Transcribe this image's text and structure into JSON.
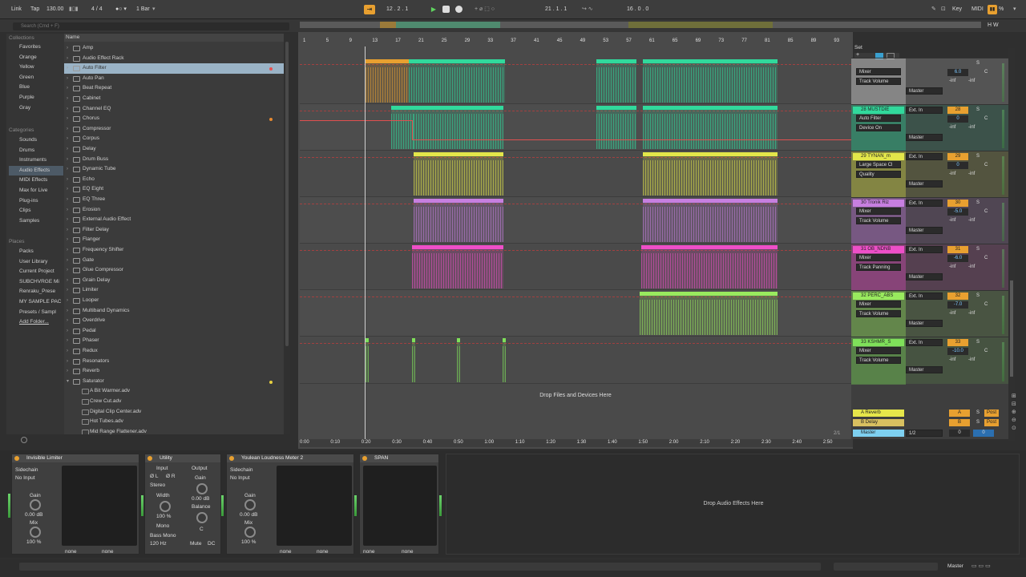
{
  "top": {
    "link": "Link",
    "tap": "Tap",
    "tempo": "130.00",
    "sig": "4 / 4",
    "quant": "1 Bar",
    "pos": "12 .  2 .  1",
    "loop_start": "21 .  1 .  1",
    "loop_len": "16 .  0 .  0",
    "key": "Key",
    "midi": "MIDI",
    "cpu": "%"
  },
  "browser": {
    "search": "Search (Cmd + F)",
    "collections_title": "Collections",
    "collections": [
      {
        "label": "Favorites",
        "color": "#e85050"
      },
      {
        "label": "Orange",
        "color": "#e88a30"
      },
      {
        "label": "Yellow",
        "color": "#e8d040"
      },
      {
        "label": "Green",
        "color": "#60c060"
      },
      {
        "label": "Blue",
        "color": "#4090e0"
      },
      {
        "label": "Purple",
        "color": "#a060d0"
      },
      {
        "label": "Gray",
        "color": "#999999"
      }
    ],
    "categories_title": "Categories",
    "categories": [
      "Sounds",
      "Drums",
      "Instruments",
      "Audio Effects",
      "MIDI Effects",
      "Max for Live",
      "Plug-ins",
      "Clips",
      "Samples"
    ],
    "places_title": "Places",
    "places": [
      "Packs",
      "User Library",
      "Current Project",
      "SUBCHVRGE Mi",
      "Renraku_Prese",
      "MY SAMPLE PAC",
      "Presets / Sampl",
      "Add Folder..."
    ],
    "name_header": "Name",
    "items": [
      "Amp",
      "Audio Effect Rack",
      "Auto Filter",
      "Auto Pan",
      "Beat Repeat",
      "Cabinet",
      "Channel EQ",
      "Chorus",
      "Compressor",
      "Corpus",
      "Delay",
      "Drum Buss",
      "Dynamic Tube",
      "Echo",
      "EQ Eight",
      "EQ Three",
      "Erosion",
      "External Audio Effect",
      "Filter Delay",
      "Flanger",
      "Frequency Shifter",
      "Gate",
      "Glue Compressor",
      "Grain Delay",
      "Limiter",
      "Looper",
      "Multiband Dynamics",
      "Overdrive",
      "Pedal",
      "Phaser",
      "Redux",
      "Resonators",
      "Reverb",
      "Saturator"
    ],
    "subitems": [
      "A Bit Warmer.adv",
      "Crew Cut.adv",
      "Digital Clip Center.adv",
      "Hot Tubes.adv",
      "Mid Range Flattener.adv"
    ]
  },
  "ruler": [
    "1",
    "5",
    "9",
    "13",
    "17",
    "21",
    "25",
    "29",
    "33",
    "37",
    "41",
    "45",
    "49",
    "53",
    "57",
    "61",
    "65",
    "69",
    "73",
    "77",
    "81",
    "85",
    "89",
    "93"
  ],
  "time_ruler": [
    "0:00",
    "0:10",
    "0:20",
    "0:30",
    "0:40",
    "0:50",
    "1:00",
    "1:10",
    "1:20",
    "1:30",
    "1:40",
    "1:50",
    "2:00",
    "2:10",
    "2:20",
    "2:30",
    "2:40",
    "2:50"
  ],
  "set_label": "Set",
  "tracks": [
    {
      "name": "",
      "color": "#e6e6e6",
      "dev": "Mixer",
      "param": "Track Volume",
      "input": "",
      "num": "",
      "vol": "6.0",
      "pan": "C",
      "out": "Master"
    },
    {
      "name": "28 MUSTDIE",
      "color": "#31d99c",
      "dev": "Auto Filter",
      "param": "Device On",
      "input": "Ext. In",
      "num": "28",
      "vol": "0",
      "pan": "C",
      "out": "Master"
    },
    {
      "name": "29 TYNAN_m",
      "color": "#e3e64a",
      "dev": "Large Space Cl",
      "param": "Quality",
      "input": "Ext. In",
      "num": "29",
      "vol": "0",
      "pan": "C",
      "out": "Master"
    },
    {
      "name": "30 Tronik Riz",
      "color": "#c77fe0",
      "dev": "Mixer",
      "param": "Track Volume",
      "input": "Ext. In",
      "num": "30",
      "vol": "-5.0",
      "pan": "C",
      "out": "Master"
    },
    {
      "name": "31 OB_NDNB",
      "color": "#ee4fc8",
      "dev": "Mixer",
      "param": "Track Panning",
      "input": "Ext. In",
      "num": "31",
      "vol": "-6.0",
      "pan": "C",
      "out": "Master"
    },
    {
      "name": "32 PERC_ABS",
      "color": "#99ea5e",
      "dev": "Mixer",
      "param": "Track Volume",
      "input": "Ext. In",
      "num": "32",
      "vol": "-7.0",
      "pan": "C",
      "out": "Master"
    },
    {
      "name": "33 KSHMR_S",
      "color": "#7fe05a",
      "dev": "Mixer",
      "param": "Track Volume",
      "input": "Ext. In",
      "num": "33",
      "vol": "-10.0",
      "pan": "C",
      "out": "Master"
    }
  ],
  "inf": "-inf",
  "returns": [
    {
      "name": "A Reverb",
      "letter": "A",
      "color": "#e6e64a"
    },
    {
      "name": "B Delay",
      "letter": "B",
      "color": "#d8c060"
    }
  ],
  "master": {
    "name": "Master",
    "ratio": "1/2",
    "vol": "0",
    "pan": "0"
  },
  "post": "Post",
  "drop_files": "Drop Files and Devices Here",
  "drop_audio": "Drop Audio Effects Here",
  "status_right": "Master",
  "page_num": "2/1",
  "devices": {
    "limiter": {
      "title": "Invisible Limiter",
      "sidechain": "Sidechain",
      "input": "No Input",
      "gain": "Gain",
      "gain_val": "0.00 dB",
      "mix": "Mix",
      "mix_val": "100 %",
      "none1": "none",
      "none2": "none"
    },
    "utility": {
      "title": "Utility",
      "input": "Input",
      "output": "Output",
      "left": "Ø L",
      "right": "Ø R",
      "stereo": "Stereo",
      "gain": "Gain",
      "gain_val": "0.00 dB",
      "width": "Width",
      "width_val": "100 %",
      "balance": "Balance",
      "bal_val": "C",
      "mono": "Mono",
      "bass_mono": "Bass Mono",
      "hz": "120 Hz",
      "mute": "Mute",
      "dc": "DC"
    },
    "loudness": {
      "title": "Youlean Loudness Meter 2",
      "sidechain": "Sidechain",
      "input": "No Input",
      "gain": "Gain",
      "gain_val": "0.00 dB",
      "mix": "Mix",
      "mix_val": "100 %",
      "none1": "none",
      "none2": "none"
    },
    "span": {
      "title": "SPAN",
      "none1": "none",
      "none2": "none"
    }
  }
}
